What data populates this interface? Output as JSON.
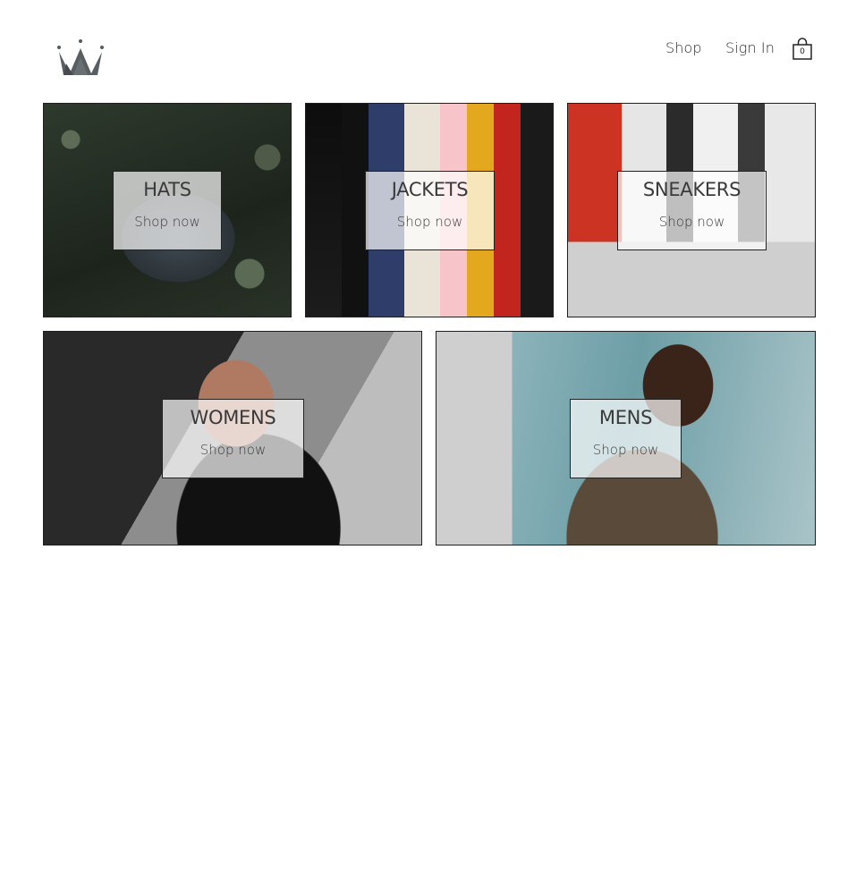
{
  "header": {
    "nav": {
      "shop": "Shop",
      "sign_in": "Sign In"
    },
    "cart_count": "0"
  },
  "categories": [
    {
      "title": "HATS",
      "cta": "Shop now"
    },
    {
      "title": "JACKETS",
      "cta": "Shop now"
    },
    {
      "title": "SNEAKERS",
      "cta": "Shop now"
    },
    {
      "title": "WOMENS",
      "cta": "Shop now"
    },
    {
      "title": "MENS",
      "cta": "Shop now"
    }
  ],
  "colors": {
    "text": "#2b2b2b",
    "border": "#1f1f1f",
    "overlay": "rgba(255,255,255,0.70)",
    "logo": "#555a5e"
  }
}
